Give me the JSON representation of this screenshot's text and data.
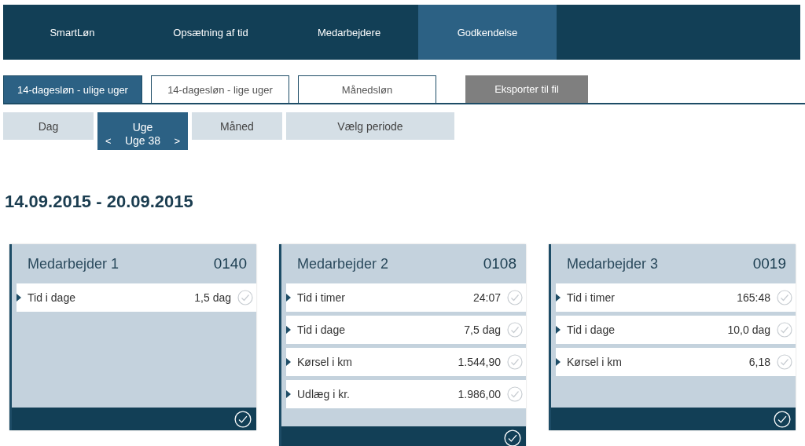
{
  "nav": [
    {
      "label": "SmartLøn",
      "selected": false
    },
    {
      "label": "Opsætning af tid",
      "selected": false
    },
    {
      "label": "Medarbejdere",
      "selected": false
    },
    {
      "label": "Godkendelse",
      "selected": true
    }
  ],
  "pay_tabs": [
    {
      "label": "14-dagesløn - ulige uger",
      "selected": true
    },
    {
      "label": "14-dagesløn - lige uger",
      "selected": false
    },
    {
      "label": "Månedsløn",
      "selected": false
    }
  ],
  "export_button": "Eksporter til fil",
  "period_tabs": [
    {
      "label": "Dag",
      "selected": false
    },
    {
      "label": "Uge",
      "selected": true,
      "nav": {
        "prev": "<",
        "label": "Uge 38",
        "next": ">"
      }
    },
    {
      "label": "Måned",
      "selected": false
    },
    {
      "label": "Vælg periode",
      "selected": false
    }
  ],
  "period_title": "14.09.2015 - 20.09.2015",
  "employees": [
    {
      "name": "Medarbejder 1",
      "number": "0140",
      "rows": [
        {
          "label": "Tid i dage",
          "value": "1,5 dag"
        }
      ]
    },
    {
      "name": "Medarbejder 2",
      "number": "0108",
      "rows": [
        {
          "label": "Tid i timer",
          "value": "24:07"
        },
        {
          "label": "Tid i dage",
          "value": "7,5 dag"
        },
        {
          "label": "Kørsel i km",
          "value": "1.544,90"
        },
        {
          "label": "Udlæg i kr.",
          "value": "1.986,00"
        }
      ]
    },
    {
      "name": "Medarbejder 3",
      "number": "0019",
      "rows": [
        {
          "label": "Tid i timer",
          "value": "165:48"
        },
        {
          "label": "Tid i dage",
          "value": "10,0 dag"
        },
        {
          "label": "Kørsel i km",
          "value": "6,18"
        }
      ]
    }
  ]
}
